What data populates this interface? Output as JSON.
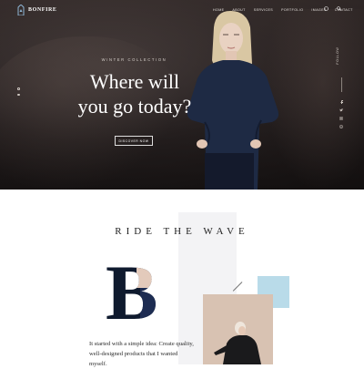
{
  "brand": {
    "name": "BONFIRE"
  },
  "nav": {
    "items": [
      "HOME",
      "ABOUT",
      "SERVICES",
      "PORTFOLIO",
      "IMAGES",
      "CONTACT"
    ]
  },
  "icons": {
    "cart": "cart-icon",
    "search": "search-icon",
    "menu": "hamburger-icon"
  },
  "hero": {
    "subtitle": "WINTER COLLECTION",
    "title_line1": "Where will",
    "title_line2": "you go today?",
    "button": "DISCOVER NOW",
    "side_label": "FOLLOW",
    "social": [
      "facebook-icon",
      "twitter-icon",
      "instagram-icon",
      "pinterest-icon"
    ]
  },
  "section": {
    "heading": "RIDE THE WAVE",
    "dropcap": "B",
    "text": "It started with a simple idea: Create quality, well-designed products that I wanted myself."
  },
  "colors": {
    "accent_blue": "#b9dbe9",
    "hero_dark": "#2d2626",
    "panel": "#f3f3f5"
  }
}
